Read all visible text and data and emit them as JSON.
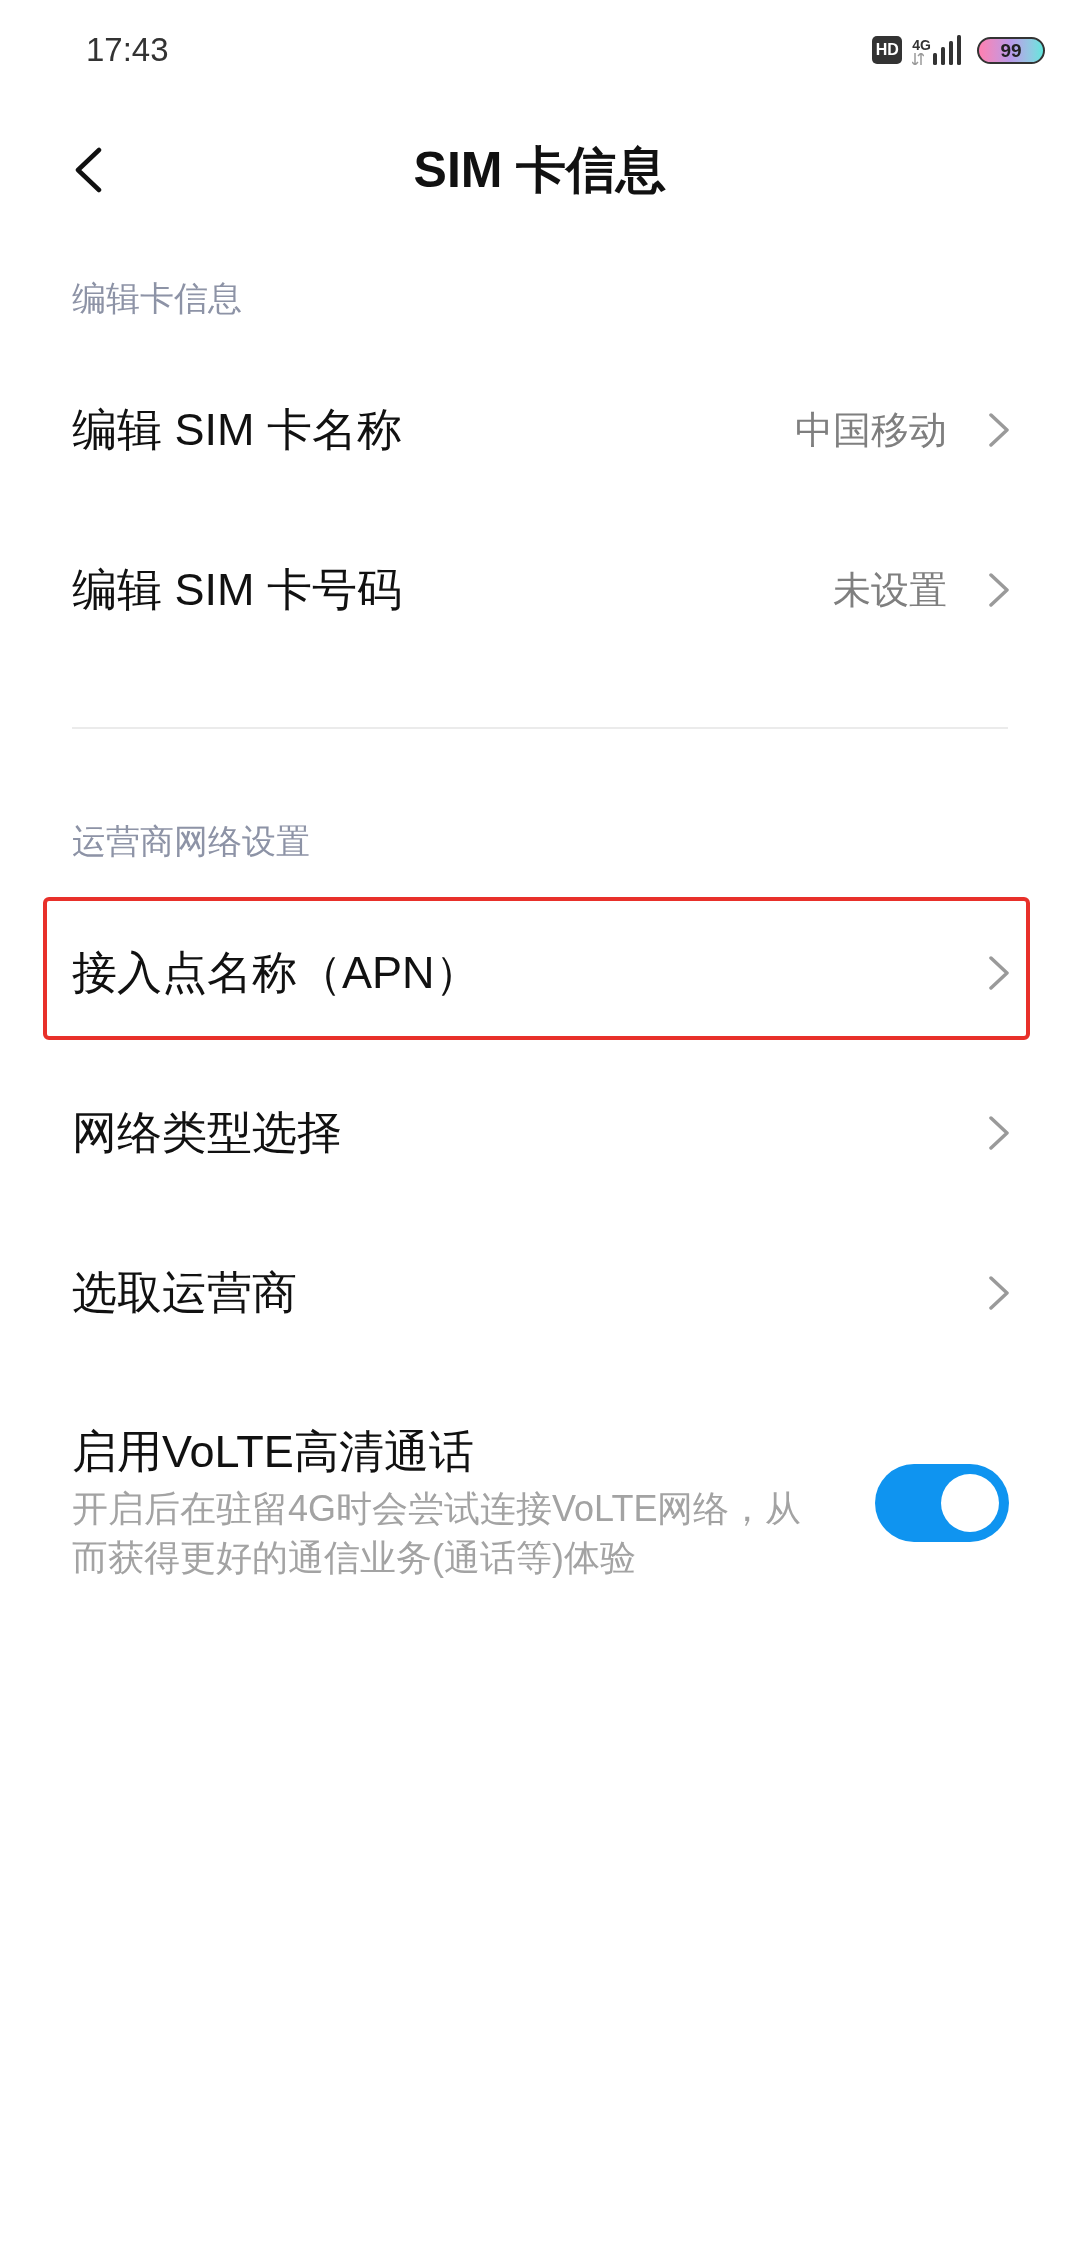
{
  "status_bar": {
    "time": "17:43",
    "hd": "HD",
    "network": "4G",
    "battery": "99"
  },
  "header": {
    "title": "SIM 卡信息"
  },
  "sections": [
    {
      "title": "编辑卡信息",
      "items": [
        {
          "kind": "link",
          "label": "编辑 SIM 卡名称",
          "value": "中国移动",
          "highlighted": false
        },
        {
          "kind": "link",
          "label": "编辑 SIM 卡号码",
          "value": "未设置",
          "highlighted": false
        }
      ]
    },
    {
      "title": "运营商网络设置",
      "items": [
        {
          "kind": "link",
          "label": "接入点名称（APN）",
          "highlighted": true
        },
        {
          "kind": "link",
          "label": "网络类型选择",
          "highlighted": false
        },
        {
          "kind": "link",
          "label": "选取运营商",
          "highlighted": false
        },
        {
          "kind": "toggle",
          "label": "启用VoLTE高清通话",
          "description": "开启后在驻留4G时会尝试连接VoLTE网络，从而获得更好的通信业务(通话等)体验",
          "on": true
        }
      ]
    }
  ]
}
